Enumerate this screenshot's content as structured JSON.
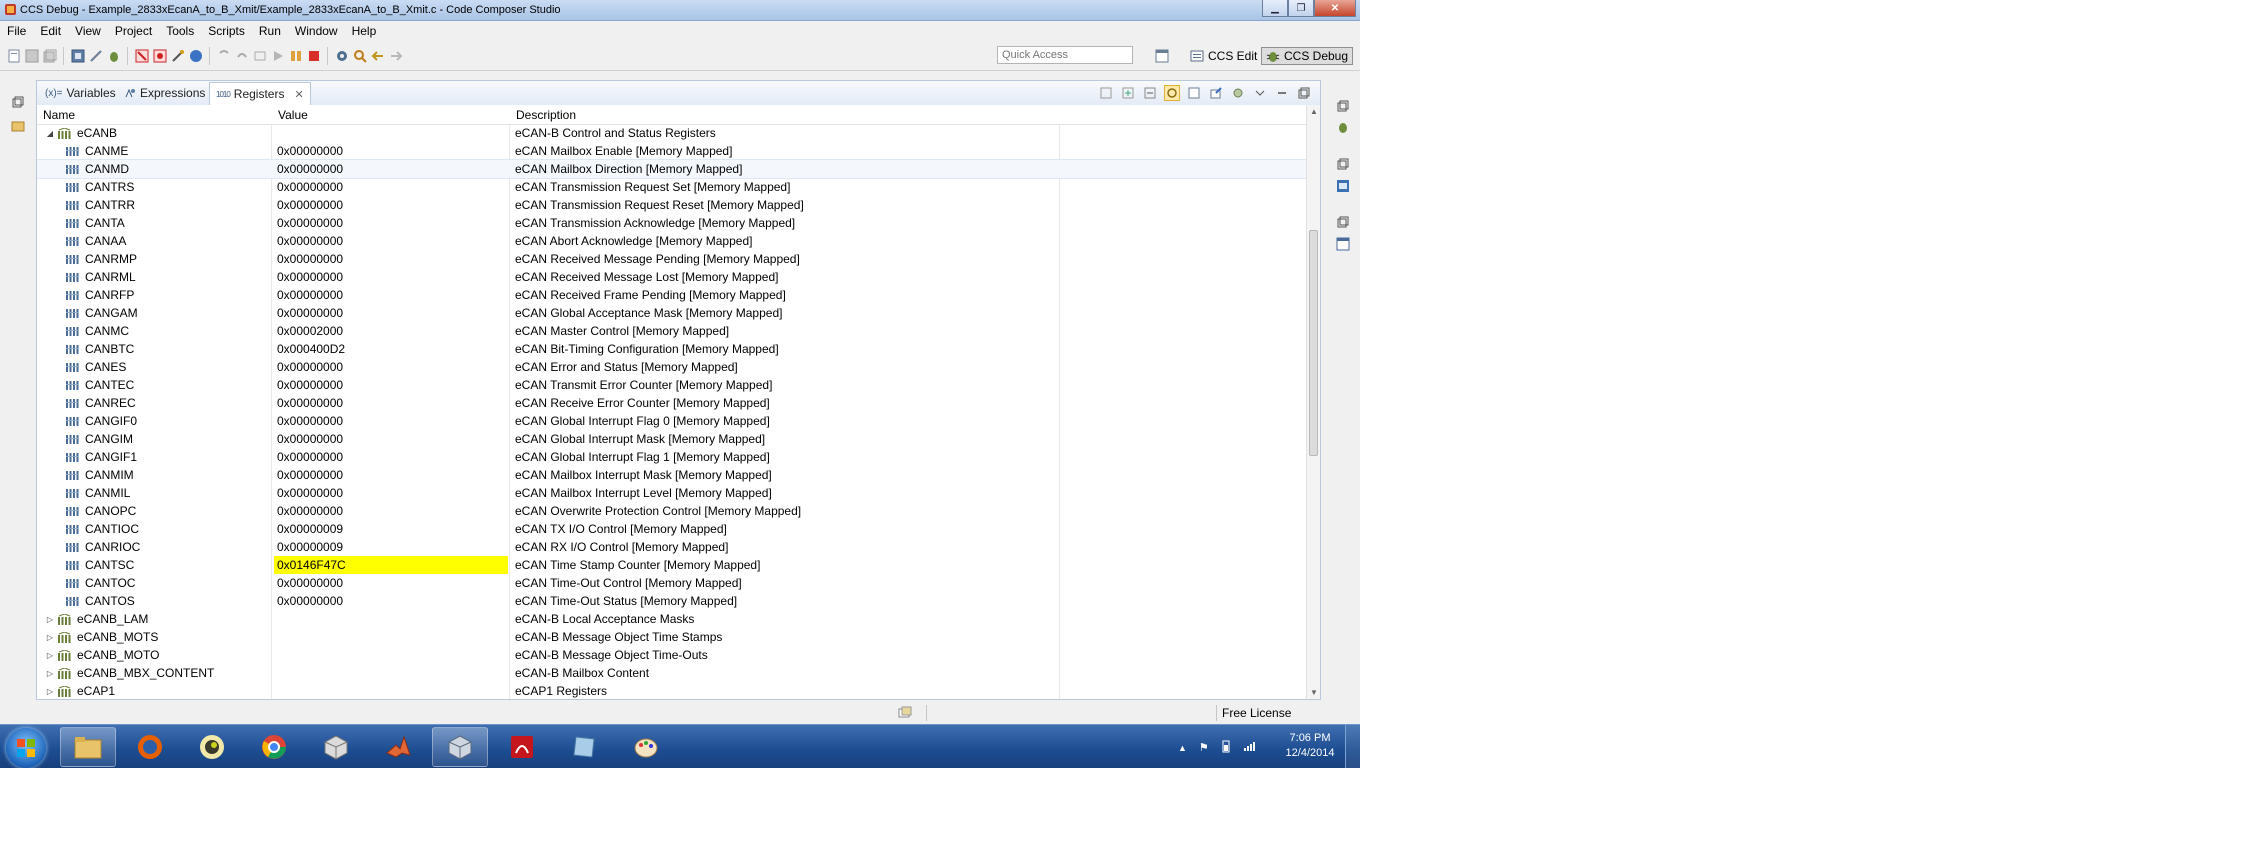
{
  "window": {
    "title": "CCS Debug - Example_2833xEcanA_to_B_Xmit/Example_2833xEcanA_to_B_Xmit.c - Code Composer Studio"
  },
  "menu": [
    "File",
    "Edit",
    "View",
    "Project",
    "Tools",
    "Scripts",
    "Run",
    "Window",
    "Help"
  ],
  "toolbar": {
    "quick_access_placeholder": "Quick Access",
    "perspectives": {
      "edit": "CCS Edit",
      "debug": "CCS Debug"
    }
  },
  "tabs": [
    {
      "label": "Variables",
      "prefix": "(x)="
    },
    {
      "label": "Expressions"
    },
    {
      "label": "Registers",
      "prefix": "1010"
    }
  ],
  "columns": {
    "name": "Name",
    "value": "Value",
    "description": "Description"
  },
  "group": {
    "name": "eCANB",
    "description": "eCAN-B Control and Status Registers"
  },
  "registers": [
    {
      "name": "CANME",
      "value": "0x00000000",
      "description": "eCAN Mailbox Enable [Memory Mapped]"
    },
    {
      "name": "CANMD",
      "value": "0x00000000",
      "description": "eCAN Mailbox Direction [Memory Mapped]"
    },
    {
      "name": "CANTRS",
      "value": "0x00000000",
      "description": "eCAN Transmission Request Set [Memory Mapped]"
    },
    {
      "name": "CANTRR",
      "value": "0x00000000",
      "description": "eCAN Transmission Request Reset [Memory Mapped]"
    },
    {
      "name": "CANTA",
      "value": "0x00000000",
      "description": "eCAN Transmission Acknowledge [Memory Mapped]"
    },
    {
      "name": "CANAA",
      "value": "0x00000000",
      "description": "eCAN Abort Acknowledge [Memory Mapped]"
    },
    {
      "name": "CANRMP",
      "value": "0x00000000",
      "description": "eCAN Received Message Pending [Memory Mapped]"
    },
    {
      "name": "CANRML",
      "value": "0x00000000",
      "description": "eCAN Received Message Lost [Memory Mapped]"
    },
    {
      "name": "CANRFP",
      "value": "0x00000000",
      "description": "eCAN Received Frame Pending [Memory Mapped]"
    },
    {
      "name": "CANGAM",
      "value": "0x00000000",
      "description": "eCAN Global Acceptance Mask [Memory Mapped]"
    },
    {
      "name": "CANMC",
      "value": "0x00002000",
      "description": "eCAN Master Control [Memory Mapped]"
    },
    {
      "name": "CANBTC",
      "value": "0x000400D2",
      "description": "eCAN Bit-Timing Configuration [Memory Mapped]"
    },
    {
      "name": "CANES",
      "value": "0x00000000",
      "description": "eCAN Error and Status [Memory Mapped]"
    },
    {
      "name": "CANTEC",
      "value": "0x00000000",
      "description": "eCAN Transmit Error Counter [Memory Mapped]"
    },
    {
      "name": "CANREC",
      "value": "0x00000000",
      "description": "eCAN Receive Error Counter [Memory Mapped]"
    },
    {
      "name": "CANGIF0",
      "value": "0x00000000",
      "description": "eCAN Global Interrupt Flag 0 [Memory Mapped]"
    },
    {
      "name": "CANGIM",
      "value": "0x00000000",
      "description": "eCAN Global Interrupt Mask [Memory Mapped]"
    },
    {
      "name": "CANGIF1",
      "value": "0x00000000",
      "description": "eCAN Global Interrupt Flag 1 [Memory Mapped]"
    },
    {
      "name": "CANMIM",
      "value": "0x00000000",
      "description": "eCAN Mailbox Interrupt Mask [Memory Mapped]"
    },
    {
      "name": "CANMIL",
      "value": "0x00000000",
      "description": "eCAN Mailbox Interrupt Level [Memory Mapped]"
    },
    {
      "name": "CANOPC",
      "value": "0x00000000",
      "description": "eCAN Overwrite Protection Control [Memory Mapped]"
    },
    {
      "name": "CANTIOC",
      "value": "0x00000009",
      "description": "eCAN TX I/O Control [Memory Mapped]"
    },
    {
      "name": "CANRIOC",
      "value": "0x00000009",
      "description": "eCAN RX I/O Control [Memory Mapped]"
    },
    {
      "name": "CANTSC",
      "value": "0x0146F47C",
      "description": "eCAN Time Stamp Counter [Memory Mapped]",
      "changed": true
    },
    {
      "name": "CANTOC",
      "value": "0x00000000",
      "description": "eCAN Time-Out Control [Memory Mapped]"
    },
    {
      "name": "CANTOS",
      "value": "0x00000000",
      "description": "eCAN Time-Out Status [Memory Mapped]"
    }
  ],
  "groups_collapsed": [
    {
      "name": "eCANB_LAM",
      "description": "eCAN-B Local Acceptance Masks"
    },
    {
      "name": "eCANB_MOTS",
      "description": "eCAN-B Message Object Time Stamps"
    },
    {
      "name": "eCANB_MOTO",
      "description": "eCAN-B Message Object Time-Outs"
    },
    {
      "name": "eCANB_MBX_CONTENT",
      "description": "eCAN-B Mailbox Content"
    },
    {
      "name": "eCAP1",
      "description": "eCAP1 Registers"
    }
  ],
  "status": {
    "license": "Free License"
  },
  "taskbar": {
    "apps": [
      "windows-explorer",
      "firefox",
      "media-app",
      "chrome",
      "virtualbox",
      "matlab",
      "ccs-cube",
      "adobe-reader",
      "notepad-app",
      "paint"
    ],
    "clock": {
      "time": "7:06 PM",
      "date": "12/4/2014"
    }
  },
  "colors": {
    "highlight": "#ffff00",
    "taskbar": "#1c4c90"
  }
}
